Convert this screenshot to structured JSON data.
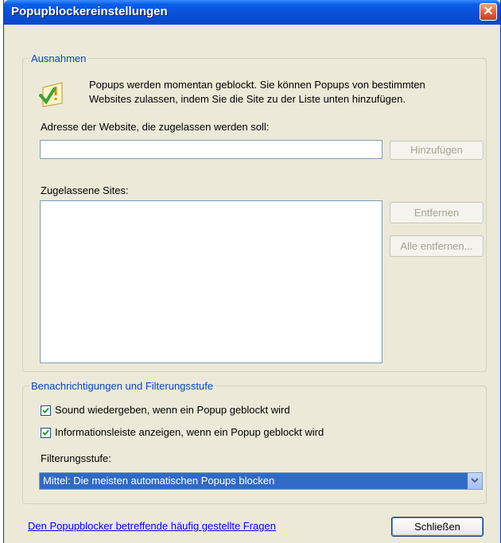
{
  "window": {
    "title": "Popupblockereinstellungen"
  },
  "exceptions": {
    "legend": "Ausnahmen",
    "info_line1": "Popups werden momentan geblockt. Sie können Popups von bestimmten",
    "info_line2": "Websites zulassen, indem Sie die Site zu der Liste unten hinzufügen.",
    "address_label": "Adresse der Website, die zugelassen werden soll:",
    "address_value": "",
    "add_button": "Hinzufügen",
    "allowed_label": "Zugelassene Sites:",
    "allowed_sites": [],
    "remove_button": "Entfernen",
    "remove_all_button": "Alle entfernen..."
  },
  "notifications": {
    "legend": "Benachrichtigungen und Filterungsstufe",
    "sound_label": "Sound wiedergeben, wenn ein Popup geblockt wird",
    "sound_checked": true,
    "infobar_label": "Informationsleiste anzeigen, wenn ein Popup geblockt wird",
    "infobar_checked": true,
    "filter_label": "Filterungsstufe:",
    "filter_value": "Mittel: Die meisten automatischen Popups blocken"
  },
  "footer": {
    "faq_link": "Den Popupblocker betreffende häufig gestellte Fragen",
    "close_button": "Schließen"
  },
  "icons": {
    "close": "close-icon",
    "info": "shield-check-icon",
    "dropdown": "chevron-down-icon",
    "check": "checkmark-icon"
  }
}
